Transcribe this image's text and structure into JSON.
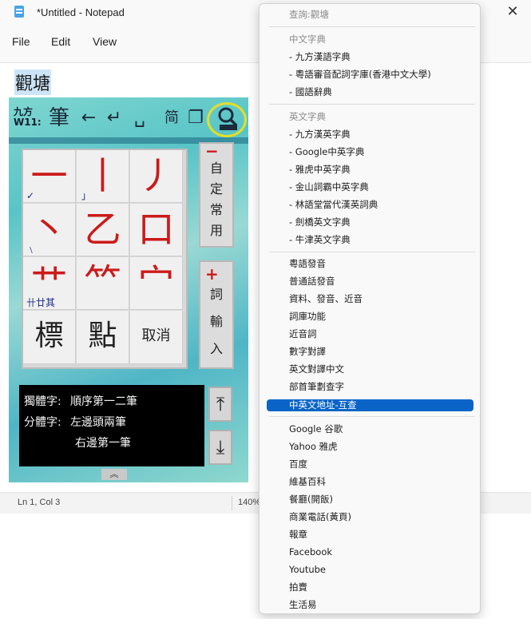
{
  "window": {
    "title": "*Untitled - Notepad",
    "close_glyph": "✕"
  },
  "menu": {
    "file": "File",
    "edit": "Edit",
    "view": "View"
  },
  "editor": {
    "text": "觀塘"
  },
  "status": {
    "position": "Ln 1, Col 3",
    "zoom": "140%"
  },
  "ime": {
    "logo_top": "九方",
    "logo_bottom": "W11:",
    "toolbar": {
      "stroke_mode": "筆",
      "back_icon": "←",
      "enter_icon": "↵",
      "space_icon": "␣",
      "simplified_toggle": "简",
      "window_icon": "❐",
      "search_icon": "search-icon"
    },
    "strokes": [
      {
        "glyph": "一",
        "sub": "✓"
      },
      {
        "glyph": "丨",
        "sub": "」"
      },
      {
        "glyph": "丿",
        "sub": ""
      },
      {
        "glyph": "丶",
        "sub": "﹨"
      },
      {
        "glyph": "乙",
        "sub": ""
      },
      {
        "glyph": "口",
        "sub": ""
      },
      {
        "glyph": "艹",
        "sub": "卄廿其"
      },
      {
        "glyph": "⺮",
        "sub": ""
      },
      {
        "glyph": "宀",
        "sub": ""
      }
    ],
    "bottom_row": {
      "key1": "標",
      "key2": "點",
      "cancel": "取消"
    },
    "side_top": {
      "sign": "−",
      "labels": [
        "自",
        "定",
        "常",
        "用"
      ]
    },
    "side_bottom": {
      "sign": "+",
      "labels": [
        "詞",
        "輸",
        "入"
      ]
    },
    "description": {
      "line1_label": "獨體字:",
      "line1_text": "順序第一二筆",
      "line2_label": "分體字:",
      "line2_text": "左邊頭兩筆",
      "line3_text": "右邊第一筆"
    },
    "scroll_up": "⤒",
    "scroll_down": "⤓",
    "expand": "︽"
  },
  "context_menu": {
    "query": "查詢:觀塘",
    "sections": {
      "chinese_dict_header": "中文字典",
      "chinese_dict_items": [
        "- 九方漢語字典",
        "- 粵語審音配詞字庫(香港中文大學)",
        "- 國語辭典"
      ],
      "english_dict_header": "英文字典",
      "english_dict_items": [
        "- 九方漢英字典",
        "- Google中英字典",
        "- 雅虎中英字典",
        "- 金山詞霸中英字典",
        "- 林語堂當代漢英詞典",
        "- 劍橋英文字典",
        "- 牛津英文字典"
      ],
      "tools": [
        "粵語發音",
        "普通話發音",
        "資料、發音、近音",
        "詞庫功能",
        "近音詞",
        "數字對譯",
        "英文對譯中文",
        "部首筆劃查字"
      ],
      "selected": "中英文地址-互查",
      "web": [
        "Google 谷歌",
        "Yahoo 雅虎",
        "百度",
        "維基百科",
        "餐廳(開飯)",
        "商業電話(黃頁)",
        "報章",
        "Facebook",
        "Youtube",
        "拍賣",
        "生活易"
      ]
    }
  }
}
